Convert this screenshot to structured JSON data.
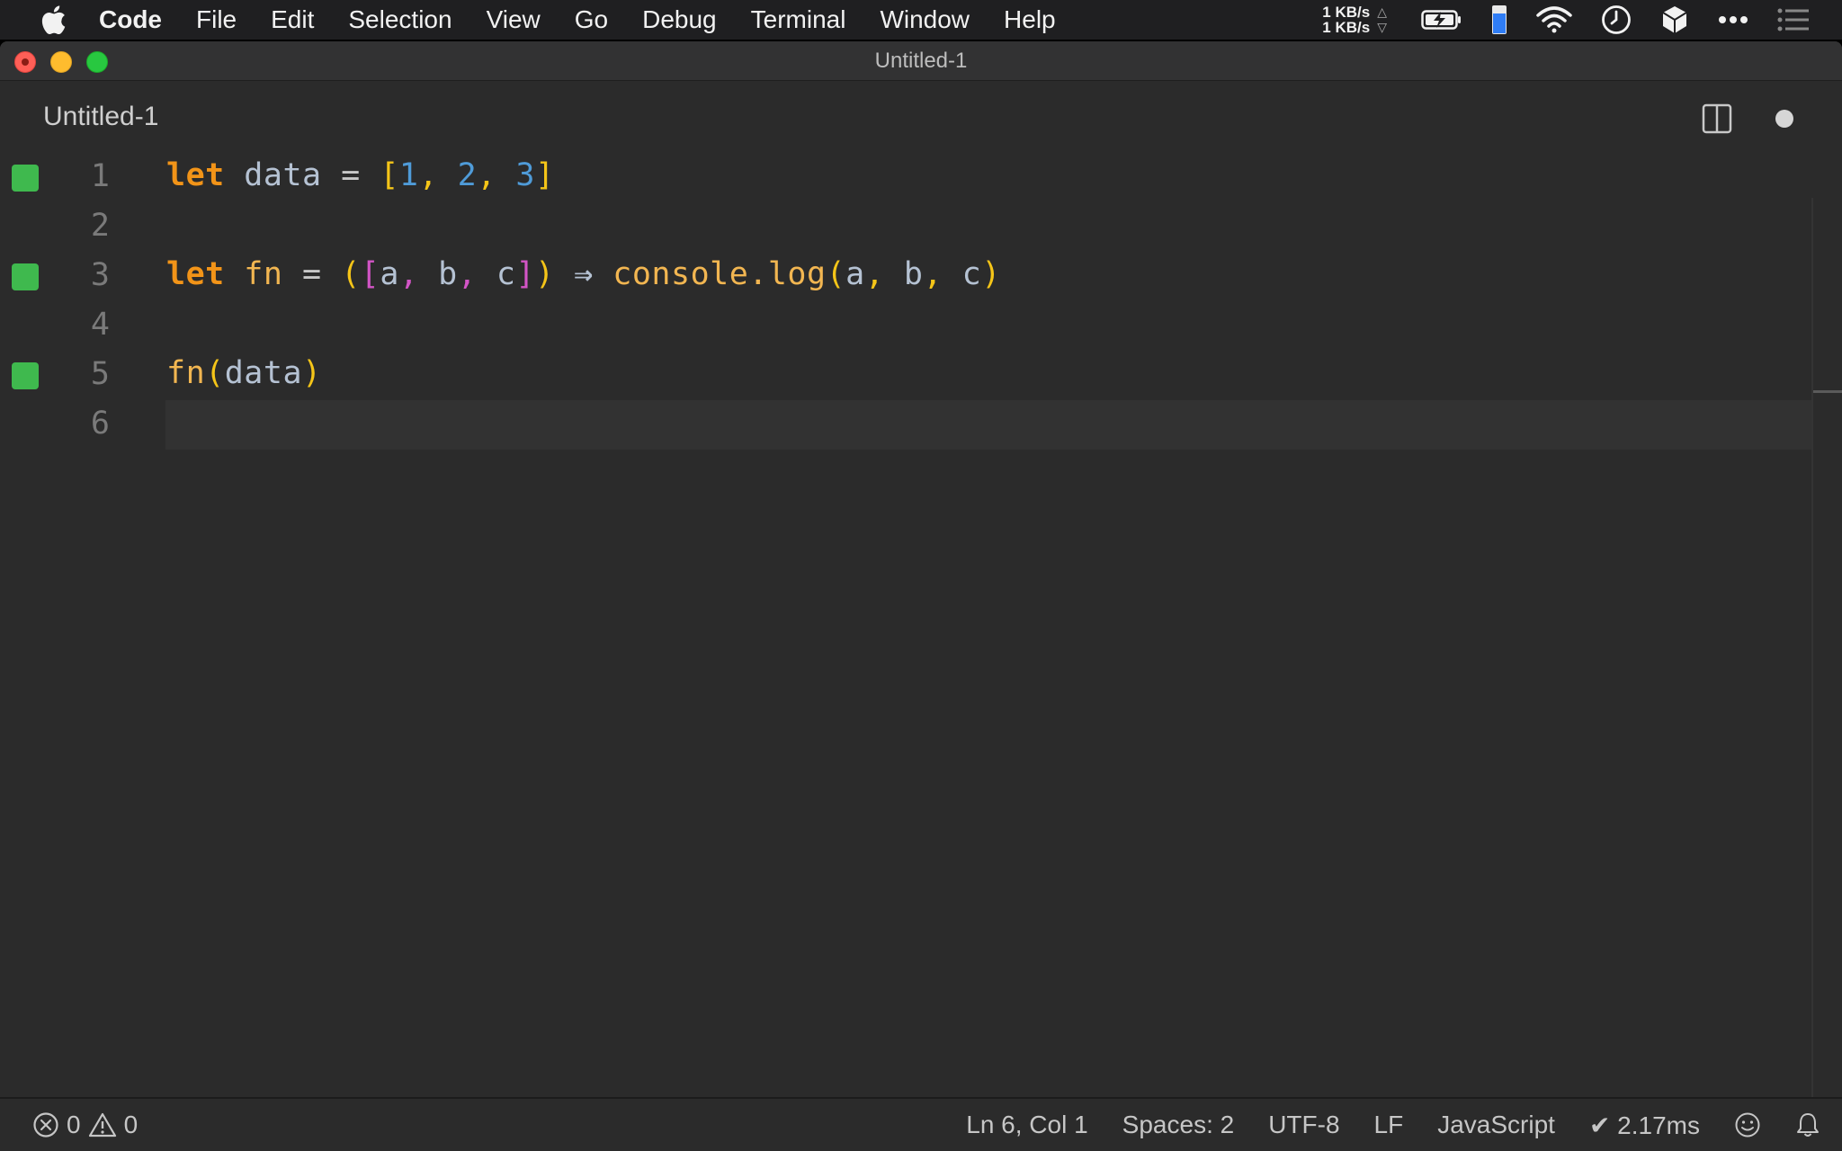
{
  "menubar": {
    "app_name": "Code",
    "menus": [
      "File",
      "Edit",
      "Selection",
      "View",
      "Go",
      "Debug",
      "Terminal",
      "Window",
      "Help"
    ],
    "net_up": "1 KB/s",
    "net_down": "1 KB/s"
  },
  "window": {
    "title": "Untitled-1"
  },
  "tab": {
    "label": "Untitled-1",
    "dirty": true
  },
  "editor": {
    "language": "javascript",
    "lines": [
      {
        "number": "1",
        "modified": true
      },
      {
        "number": "2",
        "modified": false
      },
      {
        "number": "3",
        "modified": true
      },
      {
        "number": "4",
        "modified": false
      },
      {
        "number": "5",
        "modified": true
      },
      {
        "number": "6",
        "modified": false,
        "current": true
      }
    ],
    "code": {
      "line1": {
        "kw": "let",
        "name": "data",
        "eq": "=",
        "open": "[",
        "n1": "1",
        "n2": "2",
        "n3": "3",
        "close": "]",
        "comma": ","
      },
      "line3": {
        "kw": "let",
        "name": "fn",
        "eq": "=",
        "arrow": "⇒",
        "callee": "console.log",
        "a": "a",
        "b": "b",
        "c": "c"
      },
      "line5": {
        "callee": "fn",
        "arg": "data"
      }
    }
  },
  "status": {
    "errors": "0",
    "warnings": "0",
    "position": "Ln 6, Col 1",
    "spaces": "Spaces: 2",
    "encoding": "UTF-8",
    "eol": "LF",
    "language": "JavaScript",
    "timing": "✔ 2.17ms"
  },
  "colors": {
    "keyword": "#f29418",
    "identifier": "#b5c2d3",
    "bracket_outer": "#f5c518",
    "bracket_inner": "#d355c6",
    "number": "#4f9bd8",
    "function": "#f2b651",
    "modified_gutter": "#3fb94e"
  }
}
